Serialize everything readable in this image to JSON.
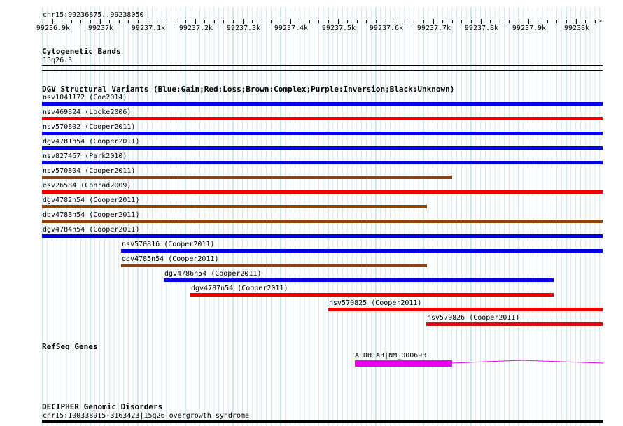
{
  "ruler": {
    "label": "chr15:99236875..99238050",
    "ticks": [
      "99236.9k",
      "99237k",
      "99237.1k",
      "99237.2k",
      "99237.3k",
      "99237.4k",
      "99237.5k",
      "99237.6k",
      "99237.7k",
      "99237.8k",
      "99237.9k",
      "99238k"
    ]
  },
  "cytoband": {
    "title": "Cytogenetic Bands",
    "band": "15q26.3"
  },
  "dgv": {
    "title": "DGV Structural Variants (Blue:Gain;Red:Loss;Brown:Complex;Purple:Inversion;Black:Unknown)",
    "colors": {
      "gain": "#0000e6",
      "loss": "#ee0000",
      "complex": "#8b4513"
    },
    "variants": [
      {
        "label": "nsv1041172 (Coe2014)",
        "type": "gain"
      },
      {
        "label": "nsv469824 (Locke2006)",
        "type": "loss"
      },
      {
        "label": "nsv570802 (Cooper2011)",
        "type": "gain"
      },
      {
        "label": "dgv4781n54 (Cooper2011)",
        "type": "gain"
      },
      {
        "label": "nsv827467 (Park2010)",
        "type": "gain"
      },
      {
        "label": "nsv570804 (Cooper2011)",
        "type": "complex"
      },
      {
        "label": "esv26584 (Conrad2009)",
        "type": "loss"
      },
      {
        "label": "dgv4782n54 (Cooper2011)",
        "type": "complex"
      },
      {
        "label": "dgv4783n54 (Cooper2011)",
        "type": "complex"
      },
      {
        "label": "dgv4784n54 (Cooper2011)",
        "type": "gain"
      },
      {
        "label": "nsv570816 (Cooper2011)",
        "type": "gain"
      },
      {
        "label": "dgv4785n54 (Cooper2011)",
        "type": "complex"
      },
      {
        "label": "dgv4786n54 (Cooper2011)",
        "type": "gain"
      },
      {
        "label": "dgv4787n54 (Cooper2011)",
        "type": "loss"
      },
      {
        "label": "nsv570825 (Cooper2011)",
        "type": "loss"
      },
      {
        "label": "nsv570826 (Cooper2011)",
        "type": "loss"
      }
    ]
  },
  "refseq": {
    "title": "RefSeq Genes",
    "gene_label": "ALDH1A3|NM_000693",
    "color": "#ee00ee"
  },
  "decipher": {
    "title": "DECIPHER Genomic Disorders",
    "entry": "chr15:100338915-3163423|15q26 overgrowth syndrome"
  }
}
